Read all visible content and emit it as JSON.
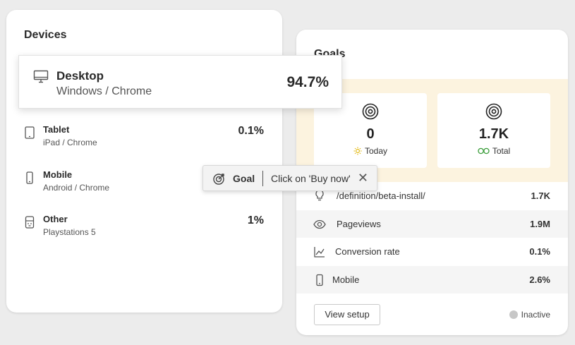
{
  "devices": {
    "title": "Devices",
    "items": [
      {
        "name": "Desktop",
        "sub": "Windows / Chrome",
        "pct": "94.7%",
        "icon": "desktop-icon"
      },
      {
        "name": "Tablet",
        "sub": "iPad / Chrome",
        "pct": "0.1%",
        "icon": "tablet-icon"
      },
      {
        "name": "Mobile",
        "sub": "Android / Chrome",
        "pct": "",
        "icon": "mobile-icon"
      },
      {
        "name": "Other",
        "sub": "Playstations 5",
        "pct": "1%",
        "icon": "gamepad-icon"
      }
    ]
  },
  "goals": {
    "title": "Goals",
    "today": {
      "value": "0",
      "label": "Today",
      "icon": "sun-icon"
    },
    "total": {
      "value": "1.7K",
      "label": "Total",
      "icon": "infinity-icon"
    },
    "rows": [
      {
        "label": "/definition/beta-install/",
        "value": "1.7K",
        "icon": "lightbulb-icon"
      },
      {
        "label": "Pageviews",
        "value": "1.9M",
        "icon": "eye-icon"
      },
      {
        "label": "Conversion rate",
        "value": "0.1%",
        "icon": "line-chart-icon"
      },
      {
        "label": "Mobile",
        "value": "2.6%",
        "icon": "mobile-icon"
      }
    ],
    "view_setup_label": "View setup",
    "status": "Inactive"
  },
  "goal_chip": {
    "type": "Goal",
    "text": "Click on 'Buy now'",
    "close": "✕"
  },
  "colors": {
    "accent_band": "#fcf3df",
    "today_sun": "#e0b400",
    "total_infinity": "#3a9d3a",
    "inactive_dot": "#c7c7c7"
  }
}
